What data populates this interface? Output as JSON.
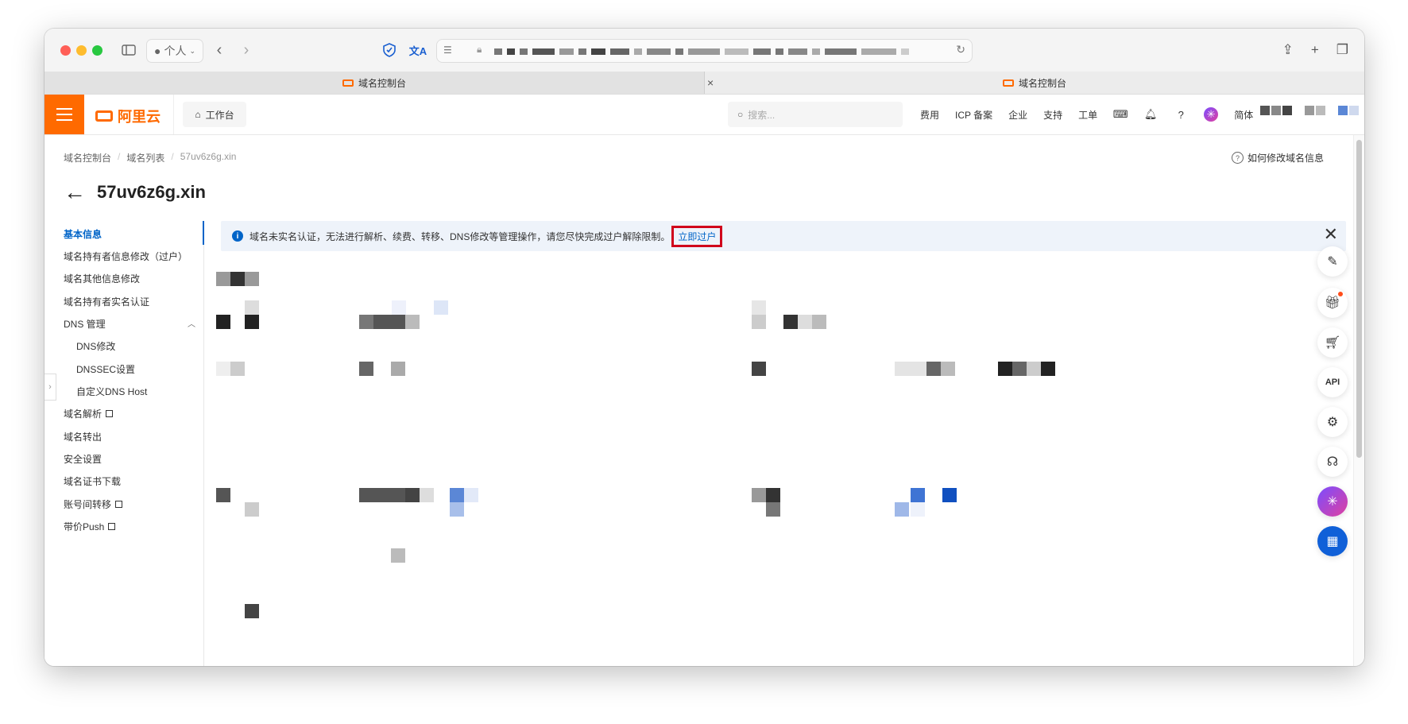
{
  "browser": {
    "profile_label": "个人",
    "tabs": [
      {
        "title": "域名控制台"
      },
      {
        "title": "域名控制台"
      }
    ]
  },
  "header": {
    "brand": "阿里云",
    "workbench": "工作台",
    "search_placeholder": "搜索...",
    "links": [
      "费用",
      "ICP 备案",
      "企业",
      "支持",
      "工单"
    ],
    "lang": "简体"
  },
  "breadcrumb": [
    "域名控制台",
    "域名列表",
    "57uv6z6g.xin"
  ],
  "help_link": "如何修改域名信息",
  "page_title": "57uv6z6g.xin",
  "sidenav": {
    "items": [
      {
        "label": "基本信息",
        "active": true
      },
      {
        "label": "域名持有者信息修改（过户）"
      },
      {
        "label": "域名其他信息修改"
      },
      {
        "label": "域名持有者实名认证"
      },
      {
        "label": "DNS 管理"
      },
      {
        "label": "DNS修改"
      },
      {
        "label": "DNSSEC设置"
      },
      {
        "label": "自定义DNS Host"
      },
      {
        "label": "域名解析"
      },
      {
        "label": "域名转出"
      },
      {
        "label": "安全设置"
      },
      {
        "label": "域名证书下载"
      },
      {
        "label": "账号间转移"
      },
      {
        "label": "带价Push"
      }
    ]
  },
  "notice": {
    "text": "域名未实名认证，无法进行解析、续费、转移、DNS修改等管理操作，请您尽快完成过户解除限制。",
    "link": "立即过户"
  },
  "colors": {
    "brand_orange": "#ff6a00",
    "link_blue": "#0064c8",
    "highlight_red": "#d0021b"
  }
}
